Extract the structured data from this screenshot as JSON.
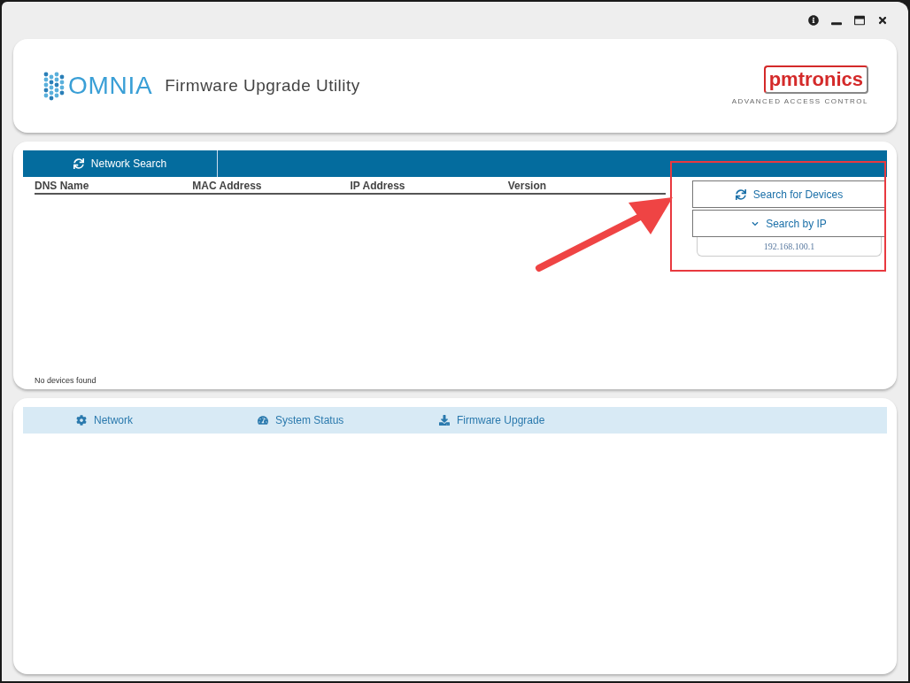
{
  "header": {
    "logo_text": "OMNIA",
    "title": "Firmware Upgrade Utility",
    "brand": {
      "name": "pmtronics",
      "tagline": "ADVANCED ACCESS CONTROL"
    }
  },
  "search_panel": {
    "tabs": [
      {
        "label": "Network Search",
        "selected": true
      }
    ],
    "table": {
      "columns": [
        "DNS Name",
        "MAC Address",
        "IP Address",
        "Version"
      ]
    },
    "status": "No devices found",
    "actions": {
      "search_button": "Search for Devices",
      "search_by_ip": {
        "label": "Search by IP",
        "expanded": true
      },
      "ip_field": {
        "value": "192.168.100.1"
      }
    }
  },
  "bottom_tabs": [
    {
      "label": "Network",
      "selected": false
    },
    {
      "label": "System Status",
      "selected": false
    },
    {
      "label": "Firmware Upgrade",
      "selected": false
    }
  ]
}
